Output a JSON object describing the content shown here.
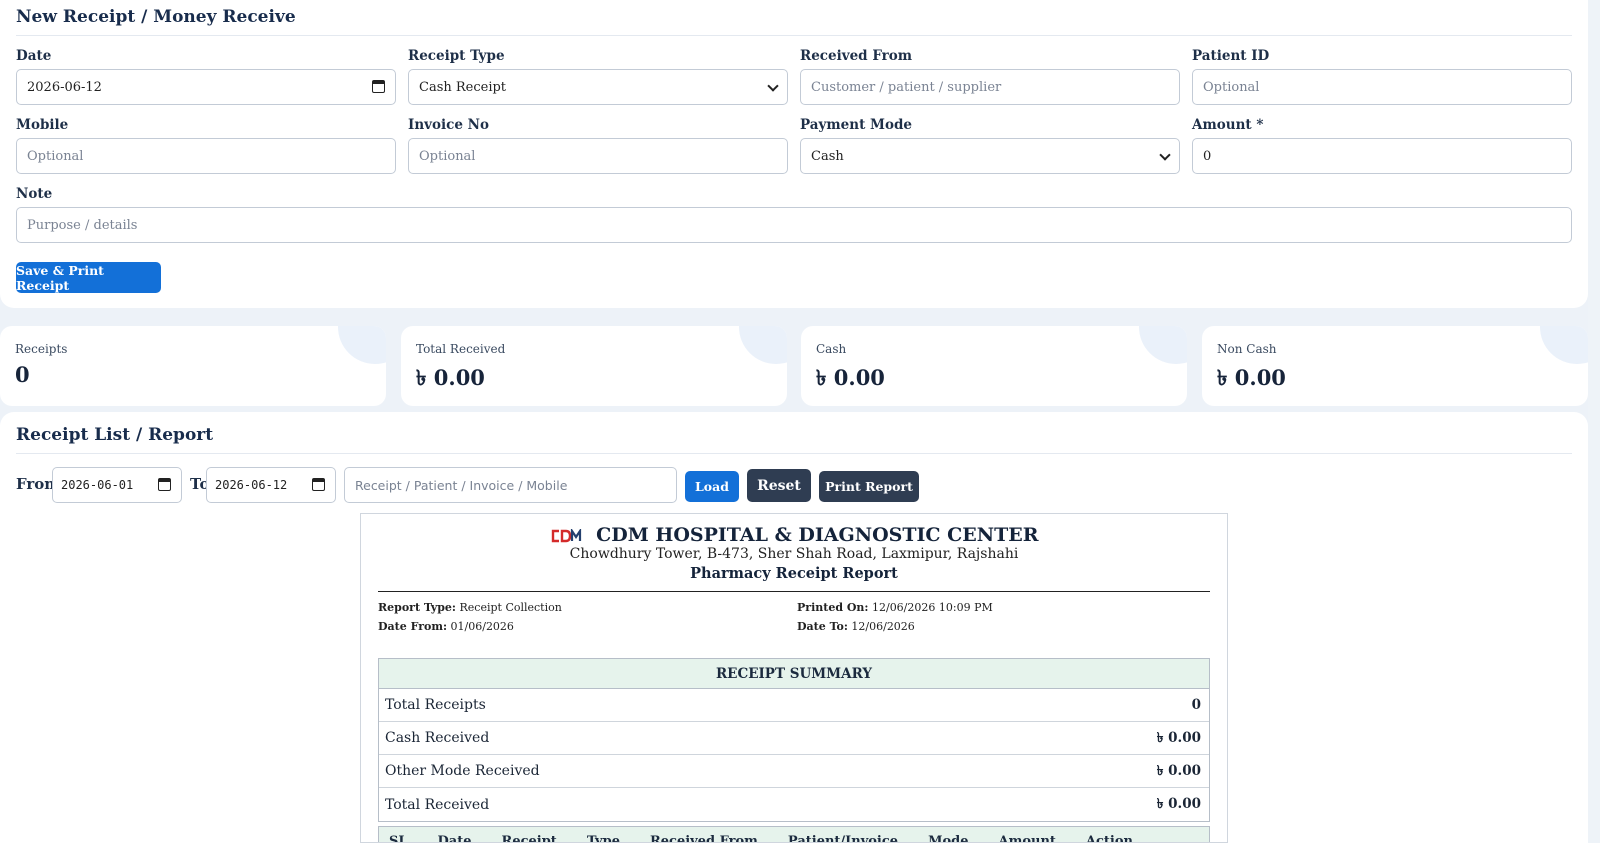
{
  "form": {
    "title": "New Receipt / Money Receive",
    "date_label": "Date",
    "date_value": "2026-06-12",
    "receipt_type_label": "Receipt Type",
    "receipt_type_value": "Cash Receipt",
    "received_from_label": "Received From",
    "received_from_placeholder": "Customer / patient / supplier",
    "patient_id_label": "Patient ID",
    "patient_id_placeholder": "Optional",
    "mobile_label": "Mobile",
    "mobile_placeholder": "Optional",
    "invoice_label": "Invoice No",
    "invoice_placeholder": "Optional",
    "payment_mode_label": "Payment Mode",
    "payment_mode_value": "Cash",
    "amount_label": "Amount *",
    "amount_value": "0",
    "note_label": "Note",
    "note_placeholder": "Purpose / details",
    "save_button": "Save & Print Receipt"
  },
  "stats": [
    {
      "label": "Receipts",
      "value": "0"
    },
    {
      "label": "Total Received",
      "value": "৳ 0.00"
    },
    {
      "label": "Cash",
      "value": "৳ 0.00"
    },
    {
      "label": "Non Cash",
      "value": "৳ 0.00"
    }
  ],
  "list": {
    "title": "Receipt List / Report",
    "from_label": "From",
    "from_value": "2026-06-01",
    "to_label": "To",
    "to_value": "2026-06-12",
    "search_placeholder": "Receipt / Patient / Invoice / Mobile",
    "load_button": "Load",
    "reset_button": "Reset",
    "print_button": "Print Report"
  },
  "report": {
    "logo_text": "CDM",
    "hospital_name": "CDM HOSPITAL & DIAGNOSTIC CENTER",
    "address": "Chowdhury Tower, B-473, Sher Shah Road, Laxmipur, Rajshahi",
    "report_title": "Pharmacy Receipt Report",
    "report_type_label": "Report Type:",
    "report_type_value": "Receipt Collection",
    "printed_on_label": "Printed On:",
    "printed_on_value": "12/06/2026 10:09 PM",
    "date_from_label": "Date From:",
    "date_from_value": "01/06/2026",
    "date_to_label": "Date To:",
    "date_to_value": "12/06/2026",
    "summary_title": "RECEIPT SUMMARY",
    "summary_rows": [
      {
        "label": "Total Receipts",
        "value": "0"
      },
      {
        "label": "Cash Received",
        "value": "৳ 0.00"
      },
      {
        "label": "Other Mode Received",
        "value": "৳ 0.00"
      },
      {
        "label": "Total Received",
        "value": "৳ 0.00"
      }
    ],
    "table_headers": [
      "SL",
      "Date",
      "Receipt",
      "Type",
      "Received From",
      "Patient/Invoice",
      "Mode",
      "Amount",
      "Action"
    ]
  },
  "colors": {
    "primary": "#1370d8",
    "dark_button": "#2f3d52",
    "summary_bg": "#e6f3ec",
    "logo_red": "#d42a2a"
  }
}
